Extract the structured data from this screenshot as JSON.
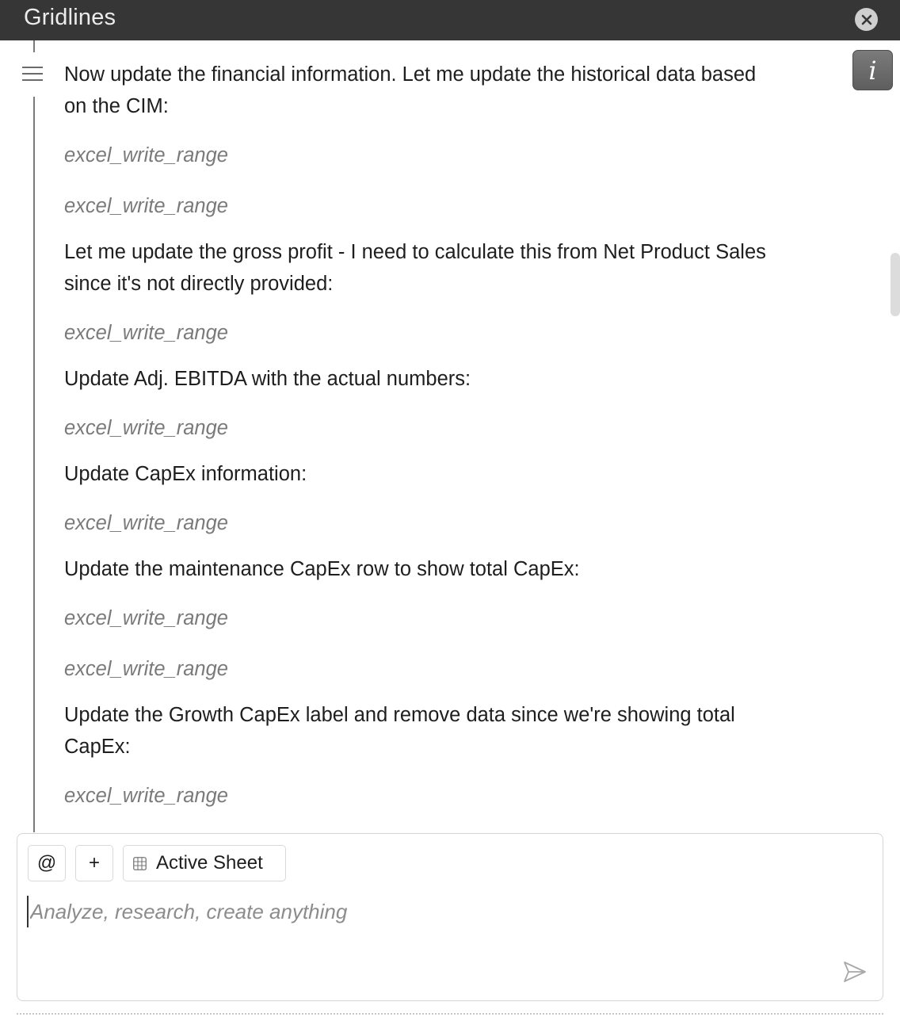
{
  "window": {
    "title": "Gridlines"
  },
  "icons": {
    "close": "close-icon",
    "info": "info-icon",
    "menu": "menu-icon",
    "send": "send-icon",
    "sheet": "table-grid-icon"
  },
  "info_glyph": "i",
  "messages": [
    {
      "type": "text",
      "lines": [
        "Now update the financial information. Let me update the historical data based",
        "on the CIM:"
      ]
    },
    {
      "type": "tool",
      "label": "excel_write_range"
    },
    {
      "type": "tool",
      "label": "excel_write_range"
    },
    {
      "type": "text",
      "lines": [
        "Let me update the gross profit - I need to calculate this from Net Product Sales",
        "since it's not directly provided:"
      ]
    },
    {
      "type": "tool",
      "label": "excel_write_range"
    },
    {
      "type": "text",
      "lines": [
        "Update Adj. EBITDA with the actual numbers:"
      ]
    },
    {
      "type": "tool",
      "label": "excel_write_range"
    },
    {
      "type": "text",
      "lines": [
        "Update CapEx information:"
      ]
    },
    {
      "type": "tool",
      "label": "excel_write_range"
    },
    {
      "type": "text",
      "lines": [
        "Update the maintenance CapEx row to show total CapEx:"
      ]
    },
    {
      "type": "tool",
      "label": "excel_write_range"
    },
    {
      "type": "tool",
      "label": "excel_write_range"
    },
    {
      "type": "text",
      "lines": [
        "Update the Growth CapEx label and remove data since we're showing total",
        "CapEx:"
      ]
    },
    {
      "type": "tool",
      "label": "excel_write_range"
    }
  ],
  "composer": {
    "mention_label": "@",
    "add_label": "+",
    "context_chip_label": "Active Sheet",
    "placeholder": "Analyze, research, create anything",
    "value": ""
  },
  "colors": {
    "titlebar": "#363636",
    "tool_text": "#7a7a7a",
    "body_text": "#1e1e1e"
  }
}
